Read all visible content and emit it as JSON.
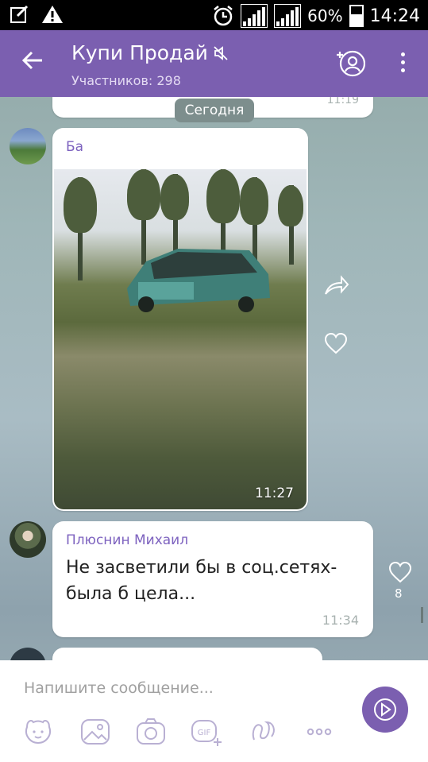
{
  "status_bar": {
    "battery_percent": "60%",
    "time": "14:24",
    "icons": [
      "edit-icon",
      "warning-icon",
      "alarm-icon",
      "signal-icon",
      "battery-icon"
    ]
  },
  "header": {
    "title": "Купи Продай",
    "subtitle": "Участников: 298",
    "colors": {
      "accent": "#7b5fb0"
    }
  },
  "chat": {
    "previous_time": "11:19",
    "date_separator": "Сегодня",
    "messages": [
      {
        "sender": "Ба",
        "type": "image",
        "time": "11:27"
      },
      {
        "sender": "Плюснин Михаил",
        "text": "Не засветили бы в соц.сетях-была б цела...",
        "time": "11:34",
        "likes": "8"
      }
    ]
  },
  "composer": {
    "placeholder": "Напишите сообщение...",
    "toolbar_icons": [
      "sticker-icon",
      "gallery-icon",
      "camera-icon",
      "gif-icon",
      "doodle-icon",
      "more-icon"
    ]
  }
}
